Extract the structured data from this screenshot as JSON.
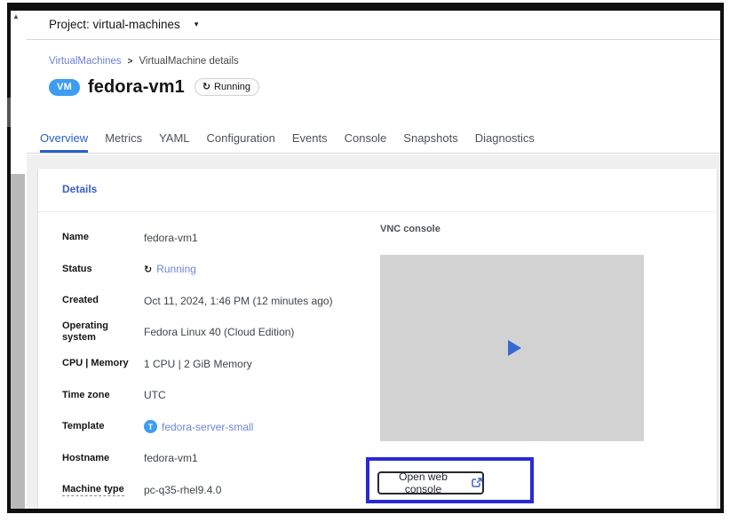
{
  "project_bar": {
    "label": "Project: virtual-machines"
  },
  "breadcrumb": {
    "link": "VirtualMachines",
    "separator": ">",
    "current": "VirtualMachine details"
  },
  "header": {
    "kind_badge": "VM",
    "title": "fedora-vm1",
    "status_label": "Running"
  },
  "tabs": [
    {
      "label": "Overview",
      "active": true
    },
    {
      "label": "Metrics"
    },
    {
      "label": "YAML"
    },
    {
      "label": "Configuration"
    },
    {
      "label": "Events"
    },
    {
      "label": "Console"
    },
    {
      "label": "Snapshots"
    },
    {
      "label": "Diagnostics"
    }
  ],
  "details_card": {
    "title": "Details",
    "rows": [
      {
        "label": "Name",
        "value": "fedora-vm1"
      },
      {
        "label": "Status",
        "value": "Running"
      },
      {
        "label": "Created",
        "value": "Oct 11, 2024, 1:46 PM (12 minutes ago)"
      },
      {
        "label": "Operating system",
        "value": "Fedora Linux 40 (Cloud Edition)"
      },
      {
        "label": "CPU | Memory",
        "value": "1 CPU | 2 GiB Memory"
      },
      {
        "label": "Time zone",
        "value": "UTC"
      },
      {
        "label": "Template",
        "value": "fedora-server-small",
        "badge": "T"
      },
      {
        "label": "Hostname",
        "value": "fedora-vm1"
      },
      {
        "label": "Machine type",
        "value": "pc-q35-rhel9.4.0"
      }
    ]
  },
  "vnc_panel": {
    "label": "VNC console",
    "open_button_label": "Open web console"
  },
  "icons": {
    "caret_down": "▾",
    "scroll_up": "▲",
    "sync": "↻"
  },
  "colors": {
    "kind_badge_blue": "#3d9cf3",
    "active_tab_blue": "#2a5fc9",
    "link_blue": "#3b5fc9",
    "light_link_blue": "#6e84dc",
    "annotation_blue": "#2a2ad6",
    "console_placeholder_gray": "#d2d2d2",
    "play_blue": "#3569cf"
  }
}
